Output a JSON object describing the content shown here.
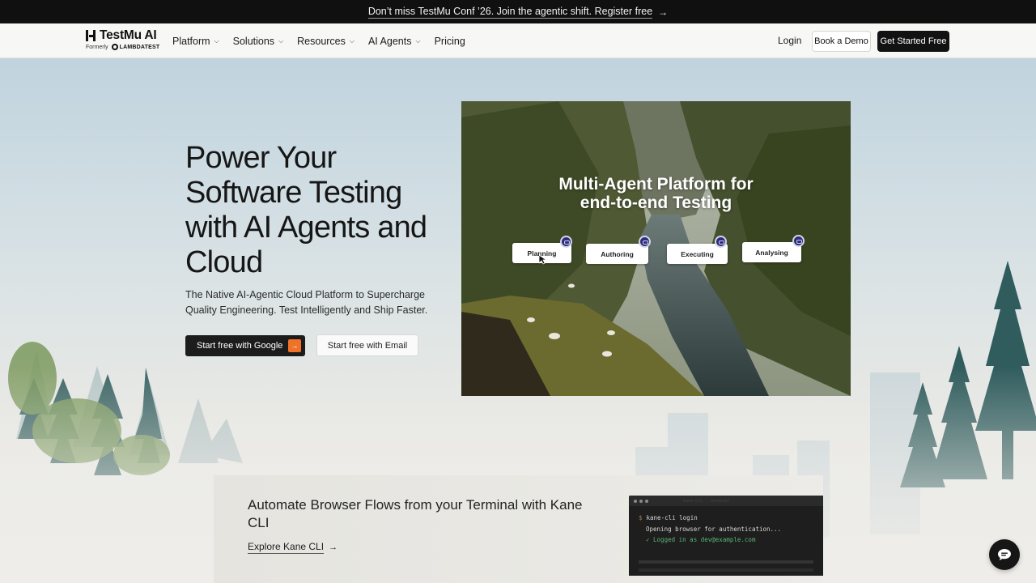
{
  "announcement": {
    "text": "Don’t miss TestMu Conf ’26. Join the agentic shift. Register free",
    "arrow_icon": "arrow-right-icon"
  },
  "header": {
    "brand": "TestMu AI",
    "formerly_label": "Formerly",
    "former_brand": "LAMBDATEST",
    "nav": [
      {
        "label": "Platform",
        "has_dropdown": true
      },
      {
        "label": "Solutions",
        "has_dropdown": true
      },
      {
        "label": "Resources",
        "has_dropdown": true
      },
      {
        "label": "AI Agents",
        "has_dropdown": true
      },
      {
        "label": "Pricing",
        "has_dropdown": false
      }
    ],
    "login_label": "Login",
    "demo_label": "Book a Demo",
    "cta_label": "Get Started Free"
  },
  "hero": {
    "title_lines": [
      "Power Your",
      "Software Testing",
      "with AI Agents and",
      "Cloud"
    ],
    "subtitle": "The Native AI-Agentic Cloud Platform to Supercharge Quality Engineering. Test Intelligently and Ship Faster.",
    "google_button": "Start free with Google",
    "email_button": "Start free with Email"
  },
  "media": {
    "title_lines": [
      "Multi-Agent Platform for",
      "end-to-end Testing"
    ],
    "stages": [
      "Planning",
      "Authoring",
      "Executing",
      "Analysing"
    ]
  },
  "kane": {
    "title": "Automate Browser Flows from your Terminal with Kane CLI",
    "link_label": "Explore Kane CLI",
    "terminal": {
      "tab_hint": "kane-cli · terminal",
      "prompt": "$",
      "command": "kane-cli login",
      "line2": "Opening browser for authentication...",
      "line3": "✓ Logged in as dev@example.com"
    }
  },
  "colors": {
    "accent": "#f07128",
    "dark": "#121212",
    "agent_badge": "#2d2e74"
  }
}
